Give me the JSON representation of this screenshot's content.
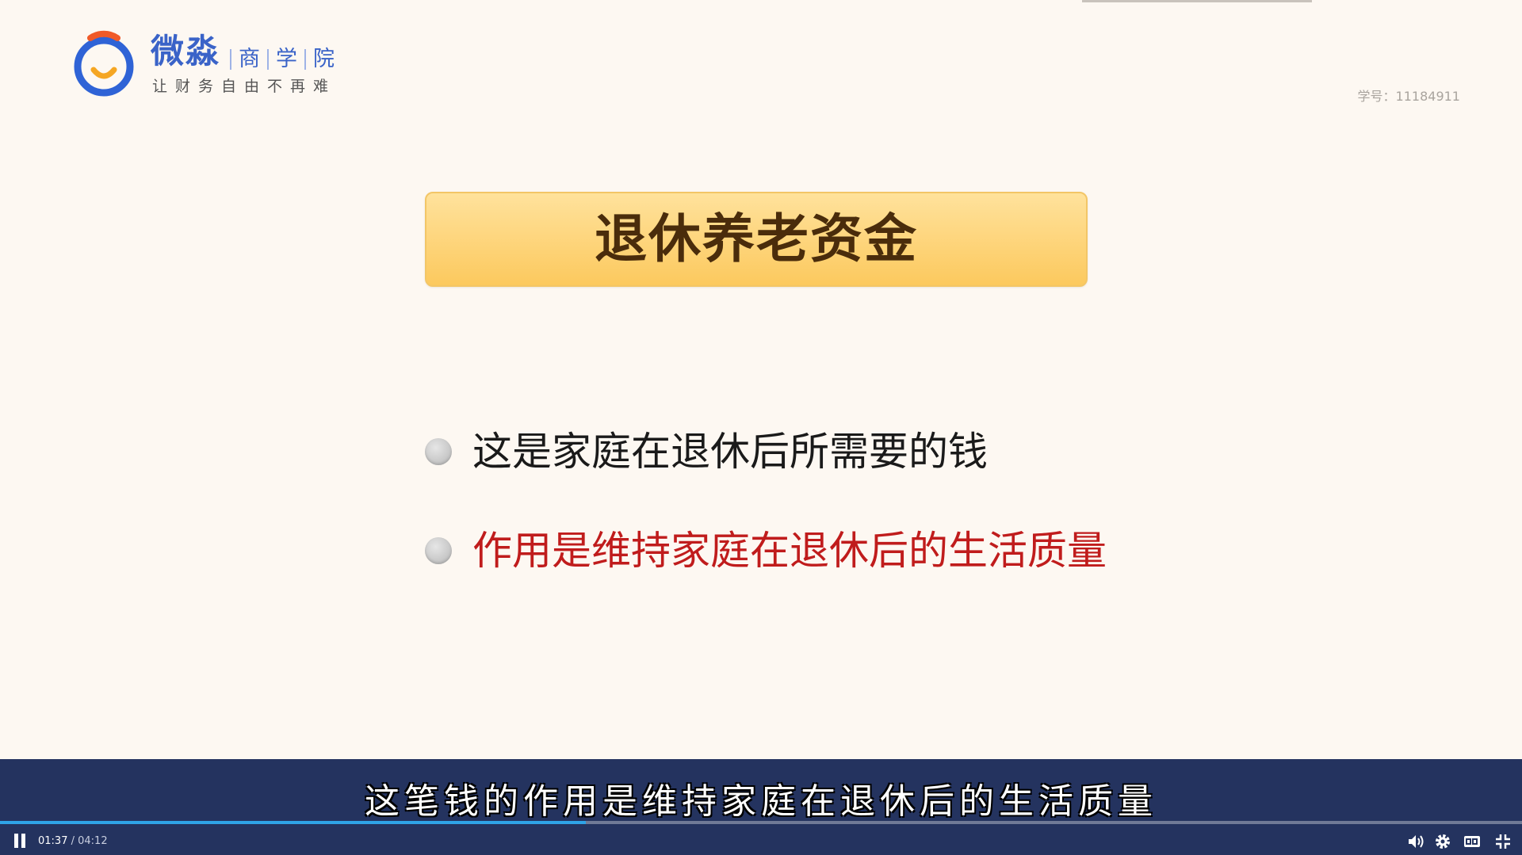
{
  "logo": {
    "brand": "微淼",
    "sub": [
      "商",
      "学",
      "院"
    ],
    "slogan": "让财务自由不再难",
    "colors": {
      "ring": "#2f63d6",
      "arc": "#f05a28",
      "smile": "#f5a623"
    }
  },
  "student_id": "学号：11184911",
  "slide": {
    "title": "退休养老资金",
    "bullets": [
      {
        "text": "这是家庭在退休后所需要的钱",
        "color": "#1a1a1a"
      },
      {
        "text": "作用是维持家庭在退休后的生活质量",
        "color": "#c01c1c"
      }
    ]
  },
  "player": {
    "subtitle": "这笔钱的作用是维持家庭在退休后的生活质量",
    "current_time": "01:37",
    "separator": " / ",
    "total_time": "04:12",
    "progress": 0.385,
    "icons": [
      "pause-icon",
      "volume-icon",
      "gear-icon",
      "captions-icon",
      "exit-fullscreen-icon"
    ],
    "accent": "#2fa4e7"
  }
}
